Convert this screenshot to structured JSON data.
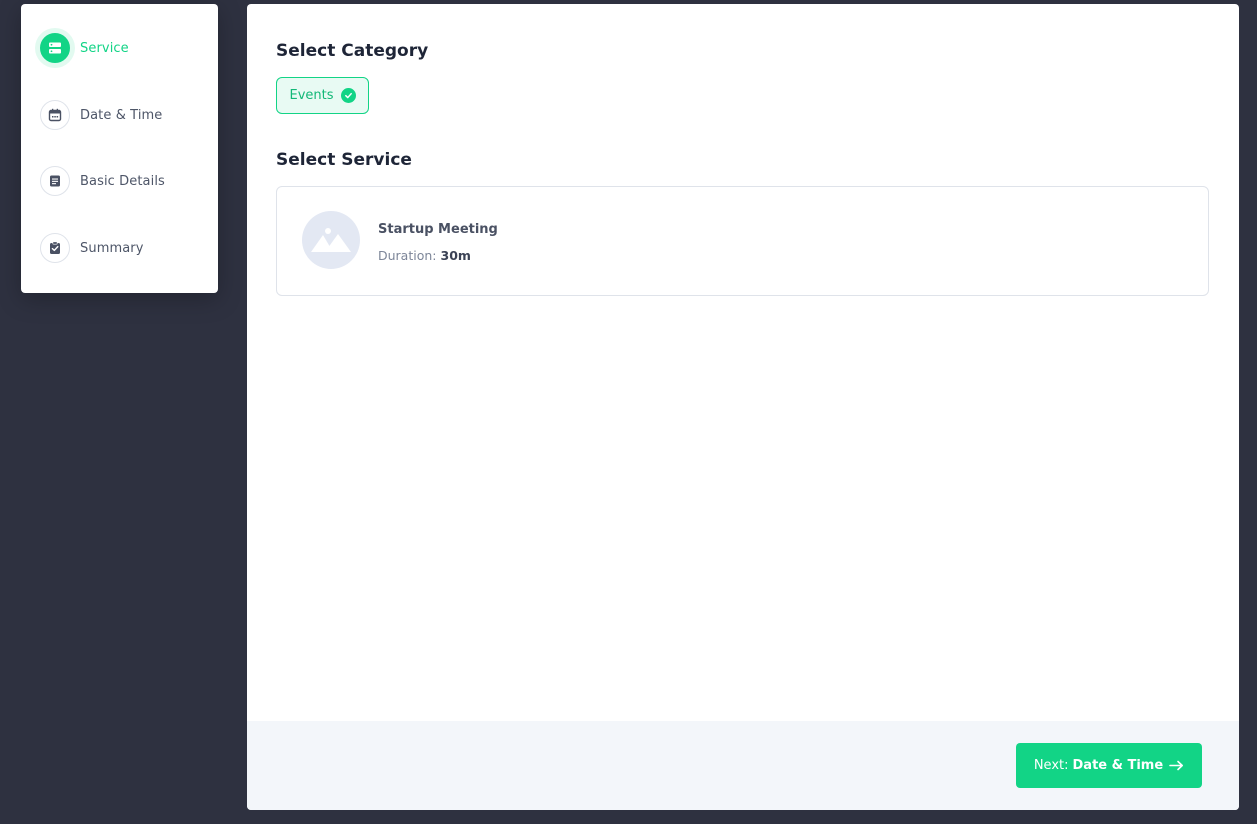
{
  "sidebar": {
    "steps": [
      {
        "label": "Service",
        "icon": "server-icon",
        "active": true
      },
      {
        "label": "Date & Time",
        "icon": "calendar-icon",
        "active": false
      },
      {
        "label": "Basic Details",
        "icon": "document-icon",
        "active": false
      },
      {
        "label": "Summary",
        "icon": "clipboard-check-icon",
        "active": false
      }
    ]
  },
  "main": {
    "category_title": "Select Category",
    "category_chip": {
      "label": "Events",
      "selected": true
    },
    "service_title": "Select Service",
    "service": {
      "name": "Startup Meeting",
      "duration_label": "Duration:",
      "duration_value": "30m"
    }
  },
  "footer": {
    "next_prefix": "Next:",
    "next_target": "Date & Time"
  },
  "colors": {
    "accent": "#12d486",
    "background": "#2e3140",
    "card": "#ffffff",
    "footer": "#f3f6fa"
  }
}
